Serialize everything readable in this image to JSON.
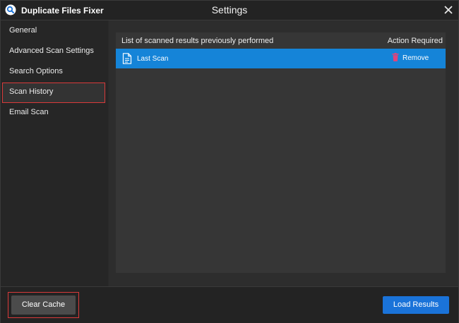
{
  "app": {
    "name": "Duplicate Files Fixer",
    "window_title": "Settings",
    "logo_icon": "magnifier-logo-icon",
    "close_icon": "close-icon"
  },
  "sidebar": {
    "items": [
      {
        "label": "General"
      },
      {
        "label": "Advanced Scan Settings"
      },
      {
        "label": "Search Options"
      },
      {
        "label": "Scan History",
        "selected": true
      },
      {
        "label": "Email Scan"
      }
    ]
  },
  "history": {
    "header_title": "List of scanned results previously performed",
    "header_action": "Action Required",
    "rows": [
      {
        "label": "Last Scan",
        "icon": "document-icon",
        "action_label": "Remove",
        "action_icon": "trash-icon"
      }
    ]
  },
  "footer": {
    "clear_cache_label": "Clear Cache",
    "load_results_label": "Load Results"
  },
  "colors": {
    "accent": "#1584d8",
    "button_primary": "#1a73d9",
    "highlight_outline": "#d93a3a",
    "trash": "#e0447c"
  }
}
